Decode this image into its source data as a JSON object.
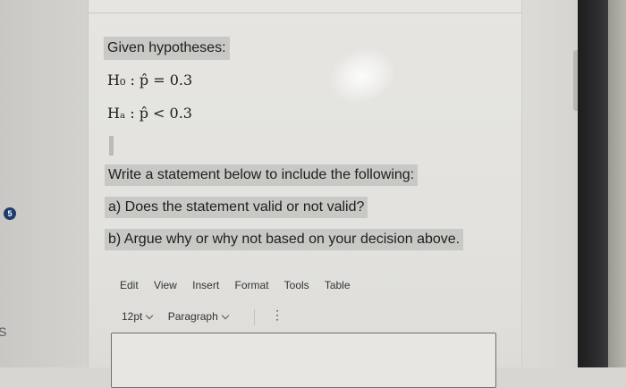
{
  "question": {
    "number": "5"
  },
  "left_clip_text": "S",
  "hypotheses": {
    "heading": "Given hypotheses:",
    "h0": "H₀ : p̂ = 0.3",
    "ha": "Hₐ : p̂ < 0.3"
  },
  "prompt": {
    "intro": "Write a statement below to include the following:",
    "a": "a) Does the statement valid or not valid?",
    "b": "b) Argue why or why not based on your decision above."
  },
  "editor_menu": [
    "Edit",
    "View",
    "Insert",
    "Format",
    "Tools",
    "Table"
  ],
  "editor_toolbar": {
    "font_size": "12pt",
    "block_format": "Paragraph",
    "more_icon": "vertical-ellipsis-icon"
  }
}
